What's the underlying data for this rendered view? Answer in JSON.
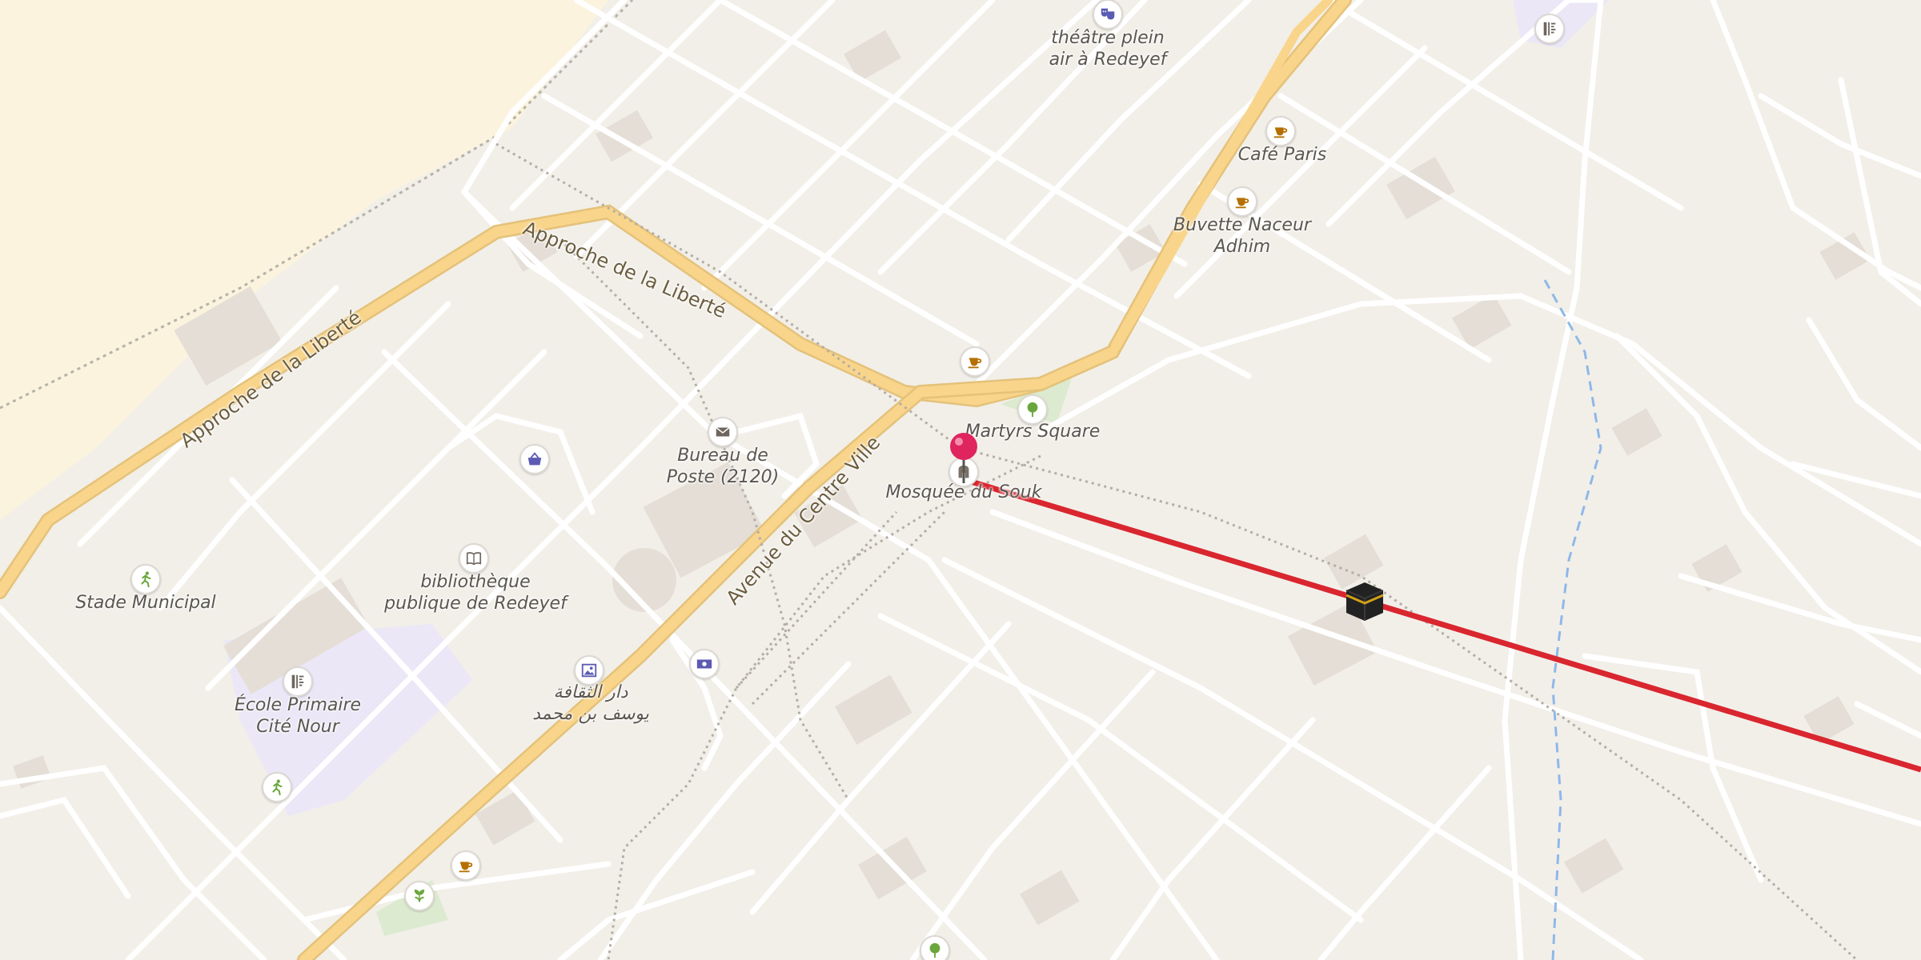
{
  "map": {
    "roads": [
      {
        "name": "Approche de la Liberté"
      },
      {
        "name": "Approche de la Liberté"
      },
      {
        "name": "Avenue du Centre Ville"
      }
    ],
    "pois": [
      {
        "id": "theatre",
        "icon": "theatre-masks-icon",
        "label_lines": [
          "théâtre plein",
          "air à Redeyef"
        ]
      },
      {
        "id": "cafe-paris",
        "icon": "coffee-cup-icon",
        "label_lines": [
          "Café Paris"
        ]
      },
      {
        "id": "buvette",
        "icon": "coffee-cup-icon",
        "label_lines": [
          "Buvette Naceur",
          "Adhim"
        ]
      },
      {
        "id": "martyrs",
        "icon": "tree-icon",
        "label_lines": [
          "Martyrs Square"
        ]
      },
      {
        "id": "cafe-unnamed",
        "icon": "coffee-cup-icon",
        "label_lines": []
      },
      {
        "id": "mosque",
        "icon": "mosque-icon",
        "label_lines": [
          "Mosquée du Souk"
        ]
      },
      {
        "id": "post",
        "icon": "envelope-icon",
        "label_lines": [
          "Bureau de",
          "Poste (2120)"
        ]
      },
      {
        "id": "shop",
        "icon": "shopping-basket-icon",
        "label_lines": []
      },
      {
        "id": "library",
        "icon": "book-icon",
        "label_lines": [
          "bibliothèque",
          "publique de Redeyef"
        ]
      },
      {
        "id": "stadium",
        "icon": "running-person-icon",
        "label_lines": [
          "Stade Municipal"
        ]
      },
      {
        "id": "school",
        "icon": "school-icon",
        "label_lines": [
          "École Primaire",
          "Cité Nour"
        ]
      },
      {
        "id": "culture",
        "icon": "picture-frame-icon",
        "label_lines": [
          "دار الثقافة",
          "يوسف بن محمد"
        ]
      },
      {
        "id": "bank",
        "icon": "banknote-icon",
        "label_lines": []
      },
      {
        "id": "school-ne",
        "icon": "school-icon",
        "label_lines": []
      },
      {
        "id": "sport-sw",
        "icon": "running-person-icon",
        "label_lines": []
      },
      {
        "id": "cafe-sw",
        "icon": "coffee-cup-icon",
        "label_lines": []
      },
      {
        "id": "garden-sw",
        "icon": "flower-icon",
        "label_lines": []
      },
      {
        "id": "tree-s",
        "icon": "tree-icon",
        "label_lines": []
      }
    ],
    "markers": {
      "location_pin": {
        "icon": "map-pin-icon",
        "color": "#e0245e"
      },
      "qibla_target": {
        "icon": "kaaba-icon"
      },
      "qibla_line_color": "#d9262f"
    },
    "colors": {
      "land": "#f2efe9",
      "sand": "#fbf3dd",
      "street": "#ffffff",
      "main_road": "#f9d48b",
      "building": "#e4ded6",
      "school_area": "#ebe7f7",
      "water": "#8fb8e8",
      "brown_icon": "#b56f00",
      "blue_icon": "#5b5bb3",
      "green_icon": "#6aa63b"
    }
  }
}
